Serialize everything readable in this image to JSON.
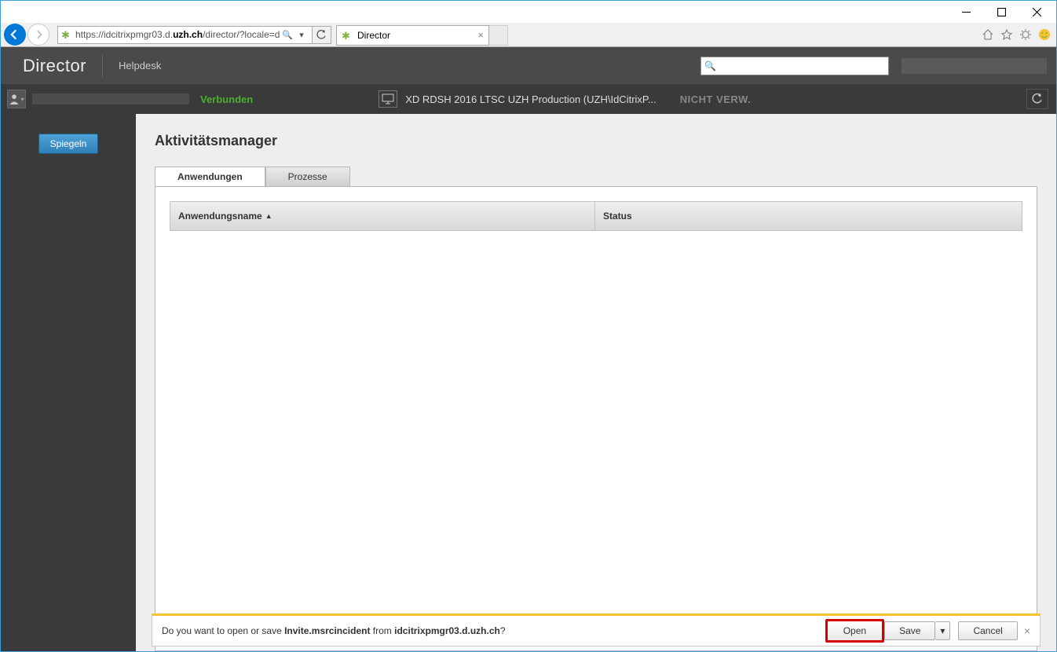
{
  "browser": {
    "url_pre": "https://idcitrixpmgr03.d.",
    "url_bold": "uzh.ch",
    "url_post": "/director/?locale=de_",
    "tab_title": "Director"
  },
  "header": {
    "logo": "Director",
    "helpdesk": "Helpdesk"
  },
  "subheader": {
    "status": "Verbunden",
    "machine": "XD RDSH 2016 LTSC UZH Production (UZH\\IdCitrixP...",
    "not_managed": "NICHT VERW."
  },
  "sidebar": {
    "mirror": "Spiegeln"
  },
  "main": {
    "title": "Aktivitätsmanager",
    "tabs": {
      "apps": "Anwendungen",
      "procs": "Prozesse"
    },
    "columns": {
      "name": "Anwendungsname",
      "status": "Status"
    }
  },
  "download": {
    "q_pre": "Do you want to open or save ",
    "file": "Invite.msrcincident",
    "q_mid": " from ",
    "host": "idcitrixpmgr03.d.uzh.ch",
    "q_post": "?",
    "open": "Open",
    "save": "Save",
    "cancel": "Cancel"
  }
}
